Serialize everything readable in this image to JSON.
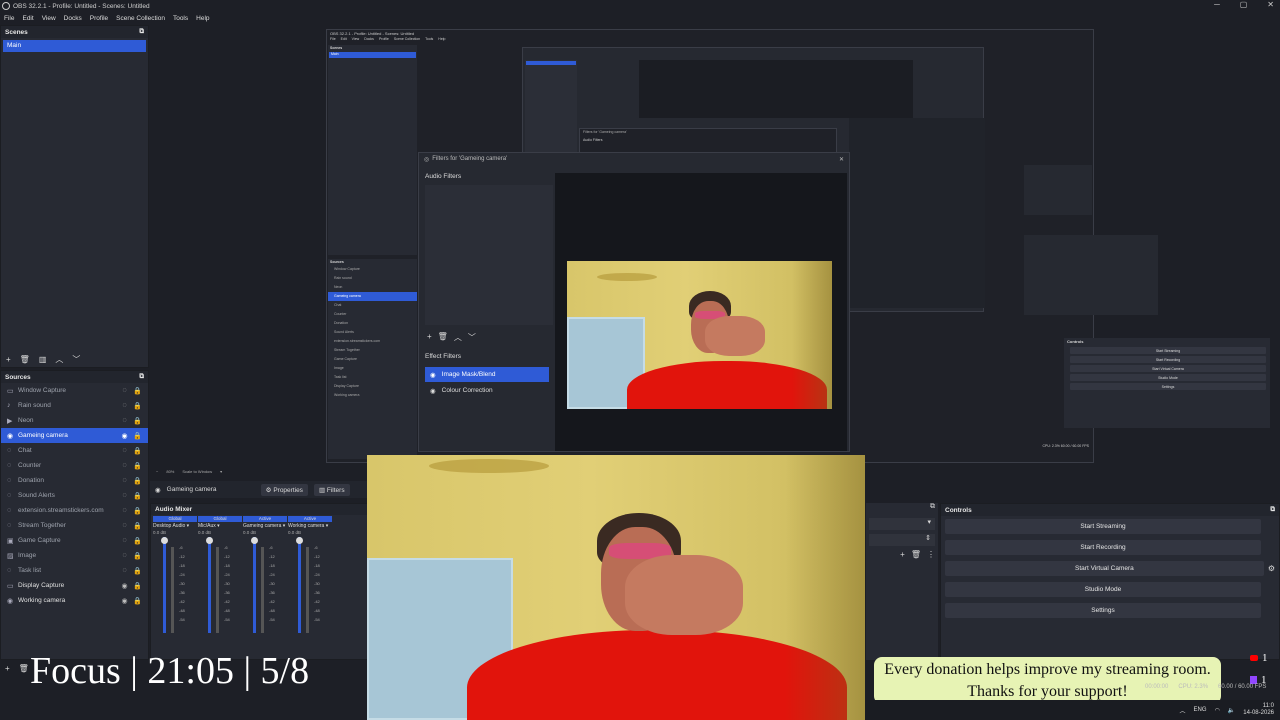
{
  "window": {
    "title": "OBS 32.2.1 - Profile: Untitled - Scenes: Untitled",
    "minimize": "─",
    "maximize": "▢",
    "close": "✕"
  },
  "menu": [
    "File",
    "Edit",
    "View",
    "Docks",
    "Profile",
    "Scene Collection",
    "Tools",
    "Help"
  ],
  "scenes": {
    "title": "Scenes",
    "items": [
      "Main"
    ]
  },
  "sources": {
    "title": "Sources",
    "items": [
      {
        "label": "Window Capture",
        "icon": "window-icon",
        "visible": false,
        "selected": false
      },
      {
        "label": "Rain sound",
        "icon": "speaker-icon",
        "visible": false,
        "selected": false
      },
      {
        "label": "Neon",
        "icon": "play-icon",
        "visible": false,
        "selected": false
      },
      {
        "label": "Gameing camera",
        "icon": "camera-icon",
        "visible": true,
        "selected": true
      },
      {
        "label": "Chat",
        "icon": "browser-icon",
        "visible": false,
        "selected": false
      },
      {
        "label": "Counter",
        "icon": "browser-icon",
        "visible": false,
        "selected": false
      },
      {
        "label": "Donation",
        "icon": "browser-icon",
        "visible": false,
        "selected": false
      },
      {
        "label": "Sound Alerts",
        "icon": "browser-icon",
        "visible": false,
        "selected": false
      },
      {
        "label": "extension.streamstickers.com",
        "icon": "browser-icon",
        "visible": false,
        "selected": false
      },
      {
        "label": "Stream Together",
        "icon": "browser-icon",
        "visible": false,
        "selected": false
      },
      {
        "label": "Game Capture",
        "icon": "gamepad-icon",
        "visible": false,
        "selected": false
      },
      {
        "label": "Image",
        "icon": "image-icon",
        "visible": false,
        "selected": false
      },
      {
        "label": "Task list",
        "icon": "browser-icon",
        "visible": false,
        "selected": false
      },
      {
        "label": "Display Capture",
        "icon": "monitor-icon",
        "visible": true,
        "selected": false
      },
      {
        "label": "Working camera",
        "icon": "camera-icon",
        "visible": true,
        "selected": false
      }
    ]
  },
  "context_bar": {
    "source": "Gameing camera",
    "properties": "Properties",
    "filters": "Filters"
  },
  "audio_mixer": {
    "title": "Audio Mixer",
    "channels": [
      {
        "tag": "Global",
        "name": "Desktop Audio",
        "level": "0.0 dB"
      },
      {
        "tag": "Global",
        "name": "Mic/Aux",
        "level": "0.0 dB"
      },
      {
        "tag": "Active",
        "name": "Gameing camera",
        "level": "0.0 dB"
      },
      {
        "tag": "Active",
        "name": "Working camera",
        "level": "0.0 dB"
      }
    ],
    "scale": [
      "-6",
      "-12",
      "-18",
      "-24",
      "-30",
      "-36",
      "-42",
      "-48",
      "-54"
    ]
  },
  "controls": {
    "title": "Controls",
    "buttons": [
      "Start Streaming",
      "Start Recording",
      "Start Virtual Camera",
      "Studio Mode",
      "Settings"
    ]
  },
  "filters_dialog": {
    "title": "Filters for 'Gameing camera'",
    "audio_filters": "Audio Filters",
    "effect_filters": "Effect Filters",
    "effects": [
      "Image Mask/Blend",
      "Colour Correction"
    ]
  },
  "nested": {
    "title": "OBS 32.2.1 - Profile: Untitled - Scenes: Untitled",
    "menu": [
      "File",
      "Edit",
      "View",
      "Docks",
      "Profile",
      "Scene Collection",
      "Tools",
      "Help"
    ],
    "scenes_title": "Scenes",
    "scene": "Main",
    "sources_title": "Sources",
    "sources": [
      "Window Capture",
      "Rain sound",
      "Neon",
      "Gameing camera",
      "Chat",
      "Counter",
      "Donation",
      "Sound Alerts",
      "extension.streamstickers.com",
      "Stream Together",
      "Game Capture",
      "Image",
      "Task list",
      "Display Capture",
      "Working camera"
    ],
    "controls_title": "Controls",
    "controls": [
      "Start Streaming",
      "Start Recording",
      "Start Virtual Camera",
      "Studio Mode",
      "Settings"
    ],
    "status": "CPU: 2.3%   60.00 / 60.00 FPS",
    "inner_filters_title": "Filters for 'Gameing camera'",
    "inner_audio_filters": "Audio Filters",
    "zoom": "80%",
    "scale_mode": "Scale to Window"
  },
  "overlay_text": "Focus | 21:05 | 5/8",
  "donation": {
    "line1": "Every donation helps improve my streaming room.",
    "line2": "Thanks for your support!"
  },
  "counts": {
    "youtube": "1",
    "twitch": "1"
  },
  "status_bar": {
    "time": "00:00:00",
    "cpu": "CPU: 2.3%",
    "fps": "60.00 / 60.00 FPS"
  },
  "taskbar": {
    "lang": "ENG",
    "clock": "11:0",
    "date": "14-08-2026"
  },
  "colors": {
    "accent": "#2f5bd6",
    "bg": "#1d1f26",
    "dock": "#272a33",
    "youtube": "#ff0000",
    "twitch": "#9146ff"
  }
}
